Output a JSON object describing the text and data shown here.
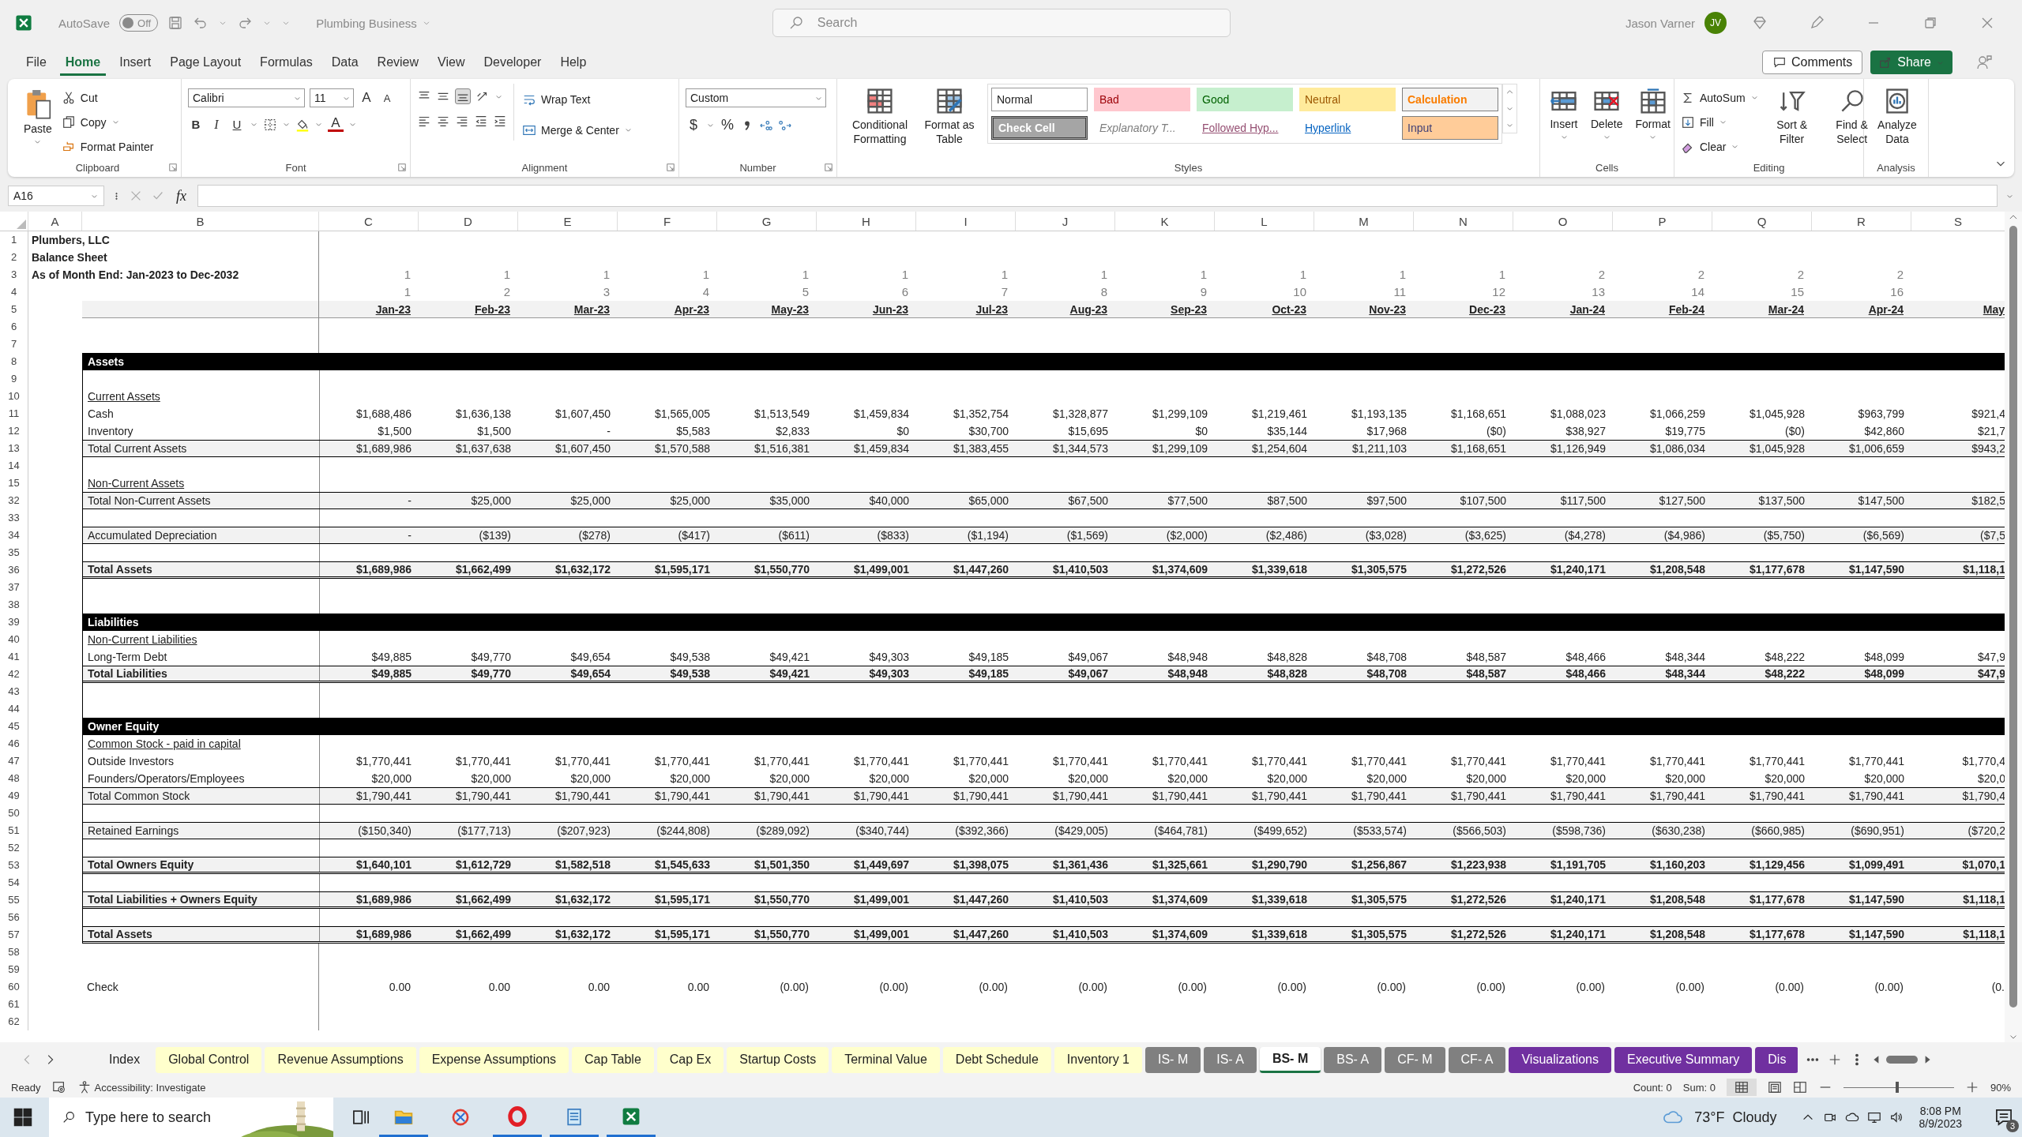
{
  "titlebar": {
    "autosave": "AutoSave",
    "autosave_toggle": {
      "label": "Off",
      "on": false
    },
    "file_name": "Plumbing Business",
    "search": {
      "placeholder": "Search"
    },
    "user": "Jason Varner",
    "avatar": "JV"
  },
  "menu": [
    {
      "label": "File",
      "selected": false
    },
    {
      "label": "Home",
      "selected": true
    },
    {
      "label": "Insert",
      "selected": false
    },
    {
      "label": "Page Layout",
      "selected": false
    },
    {
      "label": "Formulas",
      "selected": false
    },
    {
      "label": "Data",
      "selected": false
    },
    {
      "label": "Review",
      "selected": false
    },
    {
      "label": "View",
      "selected": false
    },
    {
      "label": "Developer",
      "selected": false
    },
    {
      "label": "Help",
      "selected": false
    }
  ],
  "actions": {
    "comments": "Comments",
    "share": "Share"
  },
  "ribbon": {
    "clipboard": {
      "paste": "Paste",
      "cut": "Cut",
      "copy": "Copy",
      "format_painter": "Format Painter",
      "label": "Clipboard"
    },
    "font": {
      "name": "Calibri",
      "size": "11",
      "grow": "A",
      "shrink": "A",
      "bold": "B",
      "italic": "I",
      "underline": "U",
      "font_color": "A",
      "label": "Font"
    },
    "alignment": {
      "wrap": "Wrap Text",
      "merge": "Merge & Center",
      "label": "Alignment"
    },
    "number": {
      "format": "Custom",
      "currency": "$",
      "percent": "%",
      "label": "Number"
    },
    "styles": {
      "conditional": "Conditional Formatting",
      "table": "Format as Table",
      "label": "Styles",
      "cells": [
        {
          "label": "Normal",
          "kind": "normal"
        },
        {
          "label": "Bad",
          "kind": "bad"
        },
        {
          "label": "Good",
          "kind": "good"
        },
        {
          "label": "Neutral",
          "kind": "neutral"
        },
        {
          "label": "Calculation",
          "kind": "calculation"
        },
        {
          "label": "Check Cell",
          "kind": "check"
        },
        {
          "label": "Explanatory T...",
          "kind": "explanatory"
        },
        {
          "label": "Followed Hyp...",
          "kind": "followed"
        },
        {
          "label": "Hyperlink",
          "kind": "hyperlink"
        },
        {
          "label": "Input",
          "kind": "input"
        }
      ]
    },
    "cells": {
      "insert": "Insert",
      "delete": "Delete",
      "format": "Format",
      "label": "Cells"
    },
    "editing": {
      "autosum": "AutoSum",
      "fill": "Fill",
      "clear": "Clear",
      "sort": "Sort & Filter",
      "find": "Find & Select",
      "label": "Editing"
    },
    "analysis": {
      "analyze": "Analyze Data",
      "label": "Analysis"
    }
  },
  "formula_bar": {
    "name_box": "A16",
    "fx": "fx"
  },
  "columns": [
    "A",
    "B",
    "C",
    "D",
    "E",
    "F",
    "G",
    "H",
    "I",
    "J",
    "K",
    "L",
    "M",
    "N",
    "O",
    "P",
    "Q",
    "R",
    "S"
  ],
  "rows": [
    {
      "num": "1",
      "kind": "title",
      "label": "Plumbers, LLC"
    },
    {
      "num": "2",
      "kind": "title",
      "label": "Balance Sheet"
    },
    {
      "num": "3",
      "kind": "title",
      "label": "As of Month End: Jan-2023 to Dec-2032",
      "cells": [
        "1",
        "1",
        "1",
        "1",
        "1",
        "1",
        "1",
        "1",
        "1",
        "1",
        "1",
        "1",
        "2",
        "2",
        "2",
        "2"
      ]
    },
    {
      "num": "4",
      "kind": "counter",
      "cells": [
        "1",
        "2",
        "3",
        "4",
        "5",
        "6",
        "7",
        "8",
        "9",
        "10",
        "11",
        "12",
        "13",
        "14",
        "15",
        "16"
      ]
    },
    {
      "num": "5",
      "kind": "dates",
      "cells": [
        "Jan-23",
        "Feb-23",
        "Mar-23",
        "Apr-23",
        "May-23",
        "Jun-23",
        "Jul-23",
        "Aug-23",
        "Sep-23",
        "Oct-23",
        "Nov-23",
        "Dec-23",
        "Jan-24",
        "Feb-24",
        "Mar-24",
        "Apr-24",
        "May"
      ]
    },
    {
      "num": "6",
      "kind": "blank"
    },
    {
      "num": "7",
      "kind": "blank"
    },
    {
      "num": "8",
      "kind": "section",
      "label": "Assets"
    },
    {
      "num": "9",
      "kind": "blank"
    },
    {
      "num": "10",
      "kind": "subhead",
      "label": "Current Assets"
    },
    {
      "num": "11",
      "kind": "item",
      "label": "Cash",
      "cells": [
        "$1,688,486",
        "$1,636,138",
        "$1,607,450",
        "$1,565,005",
        "$1,513,549",
        "$1,459,834",
        "$1,352,754",
        "$1,328,877",
        "$1,299,109",
        "$1,219,461",
        "$1,193,135",
        "$1,168,651",
        "$1,088,023",
        "$1,066,259",
        "$1,045,928",
        "$963,799",
        "$921,4"
      ]
    },
    {
      "num": "12",
      "kind": "item",
      "label": "Inventory",
      "cells": [
        "$1,500",
        "$1,500",
        "-",
        "$5,583",
        "$2,833",
        "$0",
        "$30,700",
        "$15,695",
        "$0",
        "$35,144",
        "$17,968",
        "($0)",
        "$38,927",
        "$19,775",
        "($0)",
        "$42,860",
        "$21,7"
      ]
    },
    {
      "num": "13",
      "kind": "total",
      "label": "Total Current Assets",
      "cells": [
        "$1,689,986",
        "$1,637,638",
        "$1,607,450",
        "$1,570,588",
        "$1,516,381",
        "$1,459,834",
        "$1,383,455",
        "$1,344,573",
        "$1,299,109",
        "$1,254,604",
        "$1,211,103",
        "$1,168,651",
        "$1,126,949",
        "$1,086,034",
        "$1,045,928",
        "$1,006,659",
        "$943,2"
      ]
    },
    {
      "num": "14",
      "kind": "blank"
    },
    {
      "num": "15",
      "kind": "subhead",
      "label": "Non-Current Assets"
    },
    {
      "num": "32",
      "kind": "total",
      "label": "Total Non-Current Assets",
      "cells": [
        "-",
        "$25,000",
        "$25,000",
        "$25,000",
        "$35,000",
        "$40,000",
        "$65,000",
        "$67,500",
        "$77,500",
        "$87,500",
        "$97,500",
        "$107,500",
        "$117,500",
        "$127,500",
        "$137,500",
        "$147,500",
        "$182,5"
      ]
    },
    {
      "num": "33",
      "kind": "blank"
    },
    {
      "num": "34",
      "kind": "total",
      "label": "Accumulated Depreciation",
      "cells": [
        "-",
        "($139)",
        "($278)",
        "($417)",
        "($611)",
        "($833)",
        "($1,194)",
        "($1,569)",
        "($2,000)",
        "($2,486)",
        "($3,028)",
        "($3,625)",
        "($4,278)",
        "($4,986)",
        "($5,750)",
        "($6,569)",
        "($7,5"
      ]
    },
    {
      "num": "35",
      "kind": "blank"
    },
    {
      "num": "36",
      "kind": "grand",
      "label": "Total Assets",
      "cells": [
        "$1,689,986",
        "$1,662,499",
        "$1,632,172",
        "$1,595,171",
        "$1,550,770",
        "$1,499,001",
        "$1,447,260",
        "$1,410,503",
        "$1,374,609",
        "$1,339,618",
        "$1,305,575",
        "$1,272,526",
        "$1,240,171",
        "$1,208,548",
        "$1,177,678",
        "$1,147,590",
        "$1,118,1"
      ]
    },
    {
      "num": "37",
      "kind": "blank"
    },
    {
      "num": "38",
      "kind": "blank"
    },
    {
      "num": "39",
      "kind": "section",
      "label": "Liabilities"
    },
    {
      "num": "40",
      "kind": "subhead",
      "label": "Non-Current Liabilities"
    },
    {
      "num": "41",
      "kind": "item",
      "label": "Long-Term Debt",
      "cells": [
        "$49,885",
        "$49,770",
        "$49,654",
        "$49,538",
        "$49,421",
        "$49,303",
        "$49,185",
        "$49,067",
        "$48,948",
        "$48,828",
        "$48,708",
        "$48,587",
        "$48,466",
        "$48,344",
        "$48,222",
        "$48,099",
        "$47,9"
      ]
    },
    {
      "num": "42",
      "kind": "grand",
      "label": "Total Liabilities",
      "cells": [
        "$49,885",
        "$49,770",
        "$49,654",
        "$49,538",
        "$49,421",
        "$49,303",
        "$49,185",
        "$49,067",
        "$48,948",
        "$48,828",
        "$48,708",
        "$48,587",
        "$48,466",
        "$48,344",
        "$48,222",
        "$48,099",
        "$47,9"
      ]
    },
    {
      "num": "43",
      "kind": "blank"
    },
    {
      "num": "44",
      "kind": "blank"
    },
    {
      "num": "45",
      "kind": "section",
      "label": "Owner Equity"
    },
    {
      "num": "46",
      "kind": "subhead",
      "label": "Common Stock - paid in capital"
    },
    {
      "num": "47",
      "kind": "item",
      "label": "Outside Investors",
      "cells": [
        "$1,770,441",
        "$1,770,441",
        "$1,770,441",
        "$1,770,441",
        "$1,770,441",
        "$1,770,441",
        "$1,770,441",
        "$1,770,441",
        "$1,770,441",
        "$1,770,441",
        "$1,770,441",
        "$1,770,441",
        "$1,770,441",
        "$1,770,441",
        "$1,770,441",
        "$1,770,441",
        "$1,770,4"
      ]
    },
    {
      "num": "48",
      "kind": "item",
      "label": "Founders/Operators/Employees",
      "cells": [
        "$20,000",
        "$20,000",
        "$20,000",
        "$20,000",
        "$20,000",
        "$20,000",
        "$20,000",
        "$20,000",
        "$20,000",
        "$20,000",
        "$20,000",
        "$20,000",
        "$20,000",
        "$20,000",
        "$20,000",
        "$20,000",
        "$20,0"
      ]
    },
    {
      "num": "49",
      "kind": "total",
      "label": "Total Common Stock",
      "cells": [
        "$1,790,441",
        "$1,790,441",
        "$1,790,441",
        "$1,790,441",
        "$1,790,441",
        "$1,790,441",
        "$1,790,441",
        "$1,790,441",
        "$1,790,441",
        "$1,790,441",
        "$1,790,441",
        "$1,790,441",
        "$1,790,441",
        "$1,790,441",
        "$1,790,441",
        "$1,790,441",
        "$1,790,4"
      ]
    },
    {
      "num": "50",
      "kind": "blank"
    },
    {
      "num": "51",
      "kind": "total",
      "label": "Retained Earnings",
      "cells": [
        "($150,340)",
        "($177,713)",
        "($207,923)",
        "($244,808)",
        "($289,092)",
        "($340,744)",
        "($392,366)",
        "($429,005)",
        "($464,781)",
        "($499,652)",
        "($533,574)",
        "($566,503)",
        "($598,736)",
        "($630,238)",
        "($660,985)",
        "($690,951)",
        "($720,2"
      ]
    },
    {
      "num": "52",
      "kind": "blank"
    },
    {
      "num": "53",
      "kind": "grand",
      "label": "Total Owners Equity",
      "cells": [
        "$1,640,101",
        "$1,612,729",
        "$1,582,518",
        "$1,545,633",
        "$1,501,350",
        "$1,449,697",
        "$1,398,075",
        "$1,361,436",
        "$1,325,661",
        "$1,290,790",
        "$1,256,867",
        "$1,223,938",
        "$1,191,705",
        "$1,160,203",
        "$1,129,456",
        "$1,099,491",
        "$1,070,1"
      ]
    },
    {
      "num": "54",
      "kind": "blank"
    },
    {
      "num": "55",
      "kind": "grand",
      "label": "Total Liabilities + Owners Equity",
      "cells": [
        "$1,689,986",
        "$1,662,499",
        "$1,632,172",
        "$1,595,171",
        "$1,550,770",
        "$1,499,001",
        "$1,447,260",
        "$1,410,503",
        "$1,374,609",
        "$1,339,618",
        "$1,305,575",
        "$1,272,526",
        "$1,240,171",
        "$1,208,548",
        "$1,177,678",
        "$1,147,590",
        "$1,118,1"
      ]
    },
    {
      "num": "56",
      "kind": "blank"
    },
    {
      "num": "57",
      "kind": "grand",
      "label": "Total Assets",
      "cells": [
        "$1,689,986",
        "$1,662,499",
        "$1,632,172",
        "$1,595,171",
        "$1,550,770",
        "$1,499,001",
        "$1,447,260",
        "$1,410,503",
        "$1,374,609",
        "$1,339,618",
        "$1,305,575",
        "$1,272,526",
        "$1,240,171",
        "$1,208,548",
        "$1,177,678",
        "$1,147,590",
        "$1,118,1"
      ]
    },
    {
      "num": "58",
      "kind": "blank"
    },
    {
      "num": "59",
      "kind": "blank"
    },
    {
      "num": "60",
      "kind": "item",
      "label": "Check",
      "cells": [
        "0.00",
        "0.00",
        "0.00",
        "0.00",
        "(0.00)",
        "(0.00)",
        "(0.00)",
        "(0.00)",
        "(0.00)",
        "(0.00)",
        "(0.00)",
        "(0.00)",
        "(0.00)",
        "(0.00)",
        "(0.00)",
        "(0.00)",
        "(0."
      ]
    },
    {
      "num": "61",
      "kind": "blank"
    },
    {
      "num": "62",
      "kind": "blank"
    }
  ],
  "sheet_tabs": [
    {
      "label": "Index",
      "selected": false
    },
    {
      "label": "Global Control",
      "selected": false,
      "color": "#ffffcc"
    },
    {
      "label": "Revenue Assumptions",
      "selected": false,
      "color": "#ffffcc"
    },
    {
      "label": "Expense Assumptions",
      "selected": false,
      "color": "#ffffcc"
    },
    {
      "label": "Cap Table",
      "selected": false,
      "color": "#ffffcc"
    },
    {
      "label": "Cap Ex",
      "selected": false,
      "color": "#ffffcc"
    },
    {
      "label": "Startup Costs",
      "selected": false,
      "color": "#ffffcc"
    },
    {
      "label": "Terminal Value",
      "selected": false,
      "color": "#ffffcc"
    },
    {
      "label": "Debt Schedule",
      "selected": false,
      "color": "#ffffcc"
    },
    {
      "label": "Inventory 1",
      "selected": false,
      "color": "#ffffcc"
    },
    {
      "label": "IS- M",
      "selected": false,
      "color": "#808080"
    },
    {
      "label": "IS- A",
      "selected": false,
      "color": "#808080"
    },
    {
      "label": "BS- M",
      "selected": true
    },
    {
      "label": "BS- A",
      "selected": false,
      "color": "#808080"
    },
    {
      "label": "CF- M",
      "selected": false,
      "color": "#808080"
    },
    {
      "label": "CF- A",
      "selected": false,
      "color": "#808080"
    },
    {
      "label": "Visualizations",
      "selected": false,
      "color": "#7030a0"
    },
    {
      "label": "Executive Summary",
      "selected": false,
      "color": "#7030a0"
    },
    {
      "label": "Dis",
      "selected": false,
      "color": "#7030a0"
    }
  ],
  "status_bar": {
    "mode": "Ready",
    "accessibility": "Accessibility: Investigate",
    "count": "Count: 0",
    "sum": "Sum: 0",
    "zoom": "90%",
    "zoom_slider": {
      "level": 0.47
    }
  },
  "taskbar": {
    "search": {
      "placeholder": "Type here to search"
    },
    "weather": "73°F  Cloudy",
    "time": "8:08 PM",
    "date": "8/9/2023",
    "notifications": "3"
  }
}
